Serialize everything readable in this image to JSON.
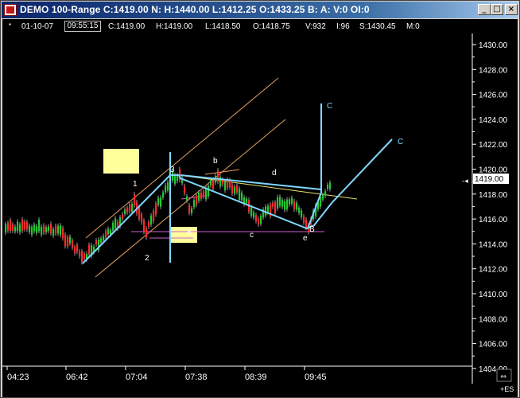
{
  "window": {
    "title": "DEMO 100-Range C:1419.00 N: H:1440.00 L:1412.25 O:1433.25 B: A: V:0 OI:0",
    "controls": {
      "minimize": "_",
      "maximize": "□",
      "close": "×"
    }
  },
  "header": {
    "date": "01-10-07",
    "time": "09:55:15",
    "close": "C:1419.00",
    "high": "H:1419.00",
    "low": "L:1418.50",
    "open": "O:1418.75",
    "volume": "V:932",
    "interval": "I:96",
    "settle": "S:1430.45",
    "mode": "M:0"
  },
  "price_axis": {
    "labels": [
      "1430.00",
      "1428.00",
      "1426.00",
      "1424.00",
      "1422.00",
      "1420.00",
      "1418.00",
      "1416.00",
      "1414.00",
      "1412.00",
      "1410.00",
      "1408.00",
      "1406.00",
      "1404.00"
    ],
    "last_price": "1419.00"
  },
  "time_axis": {
    "labels": [
      "04:23",
      "06:42",
      "07:04",
      "07:38",
      "08:39",
      "09:45"
    ]
  },
  "annotations": {
    "wave_1": "1",
    "wave_2": "2",
    "wave_3": "3",
    "wave_a": "a",
    "wave_b": "b",
    "wave_c": "c",
    "wave_d": "d",
    "wave_e": "e",
    "point_b": "B",
    "target_c1": "C",
    "target_c2": "C"
  },
  "symbol_tag": "+ES",
  "colors": {
    "up": "#ff2a2a",
    "down": "#22c832",
    "trend": "#7fd7ff",
    "channel": "#e8a060",
    "note": "#ffff99"
  }
}
